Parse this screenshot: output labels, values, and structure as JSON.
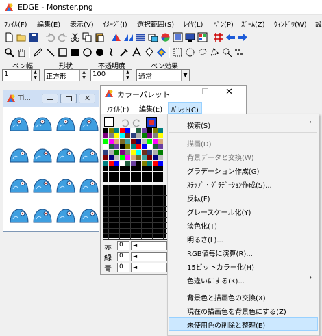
{
  "app": {
    "title": "EDGE - Monster.png"
  },
  "menubar": {
    "items": [
      "ﾌｧｲﾙ(F)",
      "編集(E)",
      "表示(V)",
      "ｲﾒｰｼﾞ(I)",
      "選択範囲(S)",
      "ﾚｲﾔ(L)",
      "ﾍﾟﾝ(P)",
      "ｽﾞｰﾑ(Z)",
      "ｳｨﾝﾄﾞｳ(W)",
      "設"
    ]
  },
  "props": {
    "pen_width_label": "ペン幅",
    "shape_label": "形状",
    "opacity_label": "不透明度",
    "pen_effect_label": "ペン効果",
    "pen_width_value": "1",
    "shape_value": "正方形",
    "opacity_value": "100",
    "pen_effect_value": "通常"
  },
  "thumb_window": {
    "title": "Ti..."
  },
  "palette_window": {
    "title": "カラーパレット",
    "menu": [
      "ﾌｧｲﾙ(F)",
      "編集(E)",
      "ﾊﾟﾚｯﾄ(C)"
    ],
    "rgb": [
      {
        "label": "赤",
        "value": "0"
      },
      {
        "label": "緑",
        "value": "0"
      },
      {
        "label": "青",
        "value": "0"
      }
    ]
  },
  "palette_menu": {
    "items": [
      {
        "label": "検索(S)",
        "enabled": true,
        "submenu": true
      },
      {
        "label": "描画(D)",
        "enabled": false
      },
      {
        "label": "背景データと交換(W)",
        "enabled": false
      },
      {
        "label": "グラデーション作成(G)",
        "enabled": true
      },
      {
        "label": "ｽﾃｯﾌﾟ・ｸﾞﾗﾃﾞｰｼｮﾝ作成(S)...",
        "enabled": true
      },
      {
        "label": "反転(F)",
        "enabled": true
      },
      {
        "label": "グレースケール化(Y)",
        "enabled": true
      },
      {
        "label": "淡色化(T)",
        "enabled": true
      },
      {
        "label": "明るさ(L)...",
        "enabled": true
      },
      {
        "label": "RGB値毎に演算(R)...",
        "enabled": true
      },
      {
        "label": "15ビットカラー化(H)",
        "enabled": true
      },
      {
        "label": "色違いにする(K)...",
        "enabled": true,
        "submenu": true
      },
      {
        "label": "背景色と描画色の交換(X)",
        "enabled": true
      },
      {
        "label": "現在の描画色を背景色にする(Z)",
        "enabled": true
      },
      {
        "label": "未使用色の削除と整理(E)",
        "enabled": true,
        "highlighted": true
      }
    ]
  },
  "colors": {
    "highlight": "#cce8ff",
    "disabled_text": "#6d6d6d",
    "thumb_title_bg": "#cfdff4",
    "monster_blue": "#3f9fe0"
  }
}
